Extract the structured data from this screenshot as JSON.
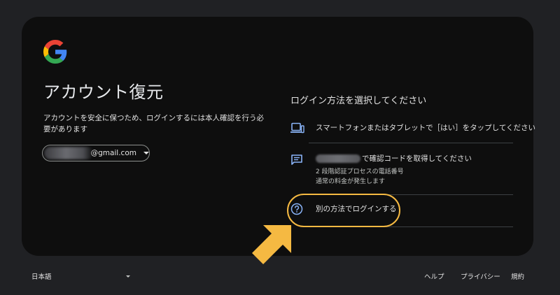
{
  "brand": {
    "logo_icon": "google-g-icon",
    "colors": {
      "blue": "#4285F4",
      "red": "#EA4335",
      "yellow": "#FBBC05",
      "green": "#34A853"
    }
  },
  "page": {
    "title": "アカウント復元",
    "subtitle": "アカウントを安全に保つため、ログインするには本人確認を行う必要があります"
  },
  "account": {
    "email_visible": "@gmail.com",
    "email_prefix_obscured": true,
    "dropdown_icon": "caret-down-icon"
  },
  "signin_methods": {
    "heading": "ログイン方法を選択してください",
    "options": [
      {
        "icon": "phone-tablet-icon",
        "label": "スマートフォンまたはタブレットで［はい］をタップしてください"
      },
      {
        "icon": "sms-message-icon",
        "label_suffix": "で確認コードを取得してください",
        "label_prefix_obscured": true,
        "details": [
          "2 段階認証プロセスの電話番号",
          "通常の料金が発生します"
        ]
      },
      {
        "icon": "help-circle-icon",
        "label": "別の方法でログインする"
      }
    ]
  },
  "annotation": {
    "color": "#F5B942",
    "arrow_icon": "arrow-pointer-icon"
  },
  "footer": {
    "language": "日本語",
    "links": [
      "ヘルプ",
      "プライバシー",
      "規約"
    ]
  }
}
